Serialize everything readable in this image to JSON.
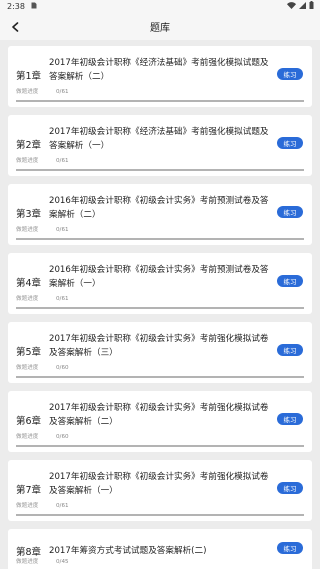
{
  "status_bar": {
    "time": "2:38",
    "sim_icon": "sim-card-icon",
    "wifi_icon": "wifi-icon",
    "signal_icon": "signal-icon",
    "battery_icon": "battery-icon"
  },
  "header": {
    "back_icon": "chevron-left-icon",
    "title": "题库"
  },
  "progress_label": "做题进度",
  "practice_label": "练习",
  "accent_color": "#2a6bd8",
  "items": [
    {
      "chapter": "第1章",
      "title": "2017年初级会计职称《经济法基础》考前强化模拟试题及答案解析（二）",
      "progress": "0/61",
      "fraction": 0
    },
    {
      "chapter": "第2章",
      "title": "2017年初级会计职称《经济法基础》考前强化模拟试题及答案解析（一）",
      "progress": "0/61",
      "fraction": 0
    },
    {
      "chapter": "第3章",
      "title": "2016年初级会计职称《初级会计实务》考前预测试卷及答案解析（二）",
      "progress": "0/61",
      "fraction": 0
    },
    {
      "chapter": "第4章",
      "title": "2016年初级会计职称《初级会计实务》考前预测试卷及答案解析（一）",
      "progress": "0/61",
      "fraction": 0
    },
    {
      "chapter": "第5章",
      "title": "2017年初级会计职称《初级会计实务》考前强化模拟试卷及答案解析（三）",
      "progress": "0/60",
      "fraction": 0
    },
    {
      "chapter": "第6章",
      "title": "2017年初级会计职称《初级会计实务》考前强化模拟试卷及答案解析（二）",
      "progress": "0/60",
      "fraction": 0
    },
    {
      "chapter": "第7章",
      "title": "2017年初级会计职称《初级会计实务》考前强化模拟试卷及答案解析（一）",
      "progress": "0/61",
      "fraction": 0
    },
    {
      "chapter": "第8章",
      "title": "2017年筹资方式考试试题及答案解析(二)",
      "progress": "0/45",
      "fraction": 0
    }
  ]
}
